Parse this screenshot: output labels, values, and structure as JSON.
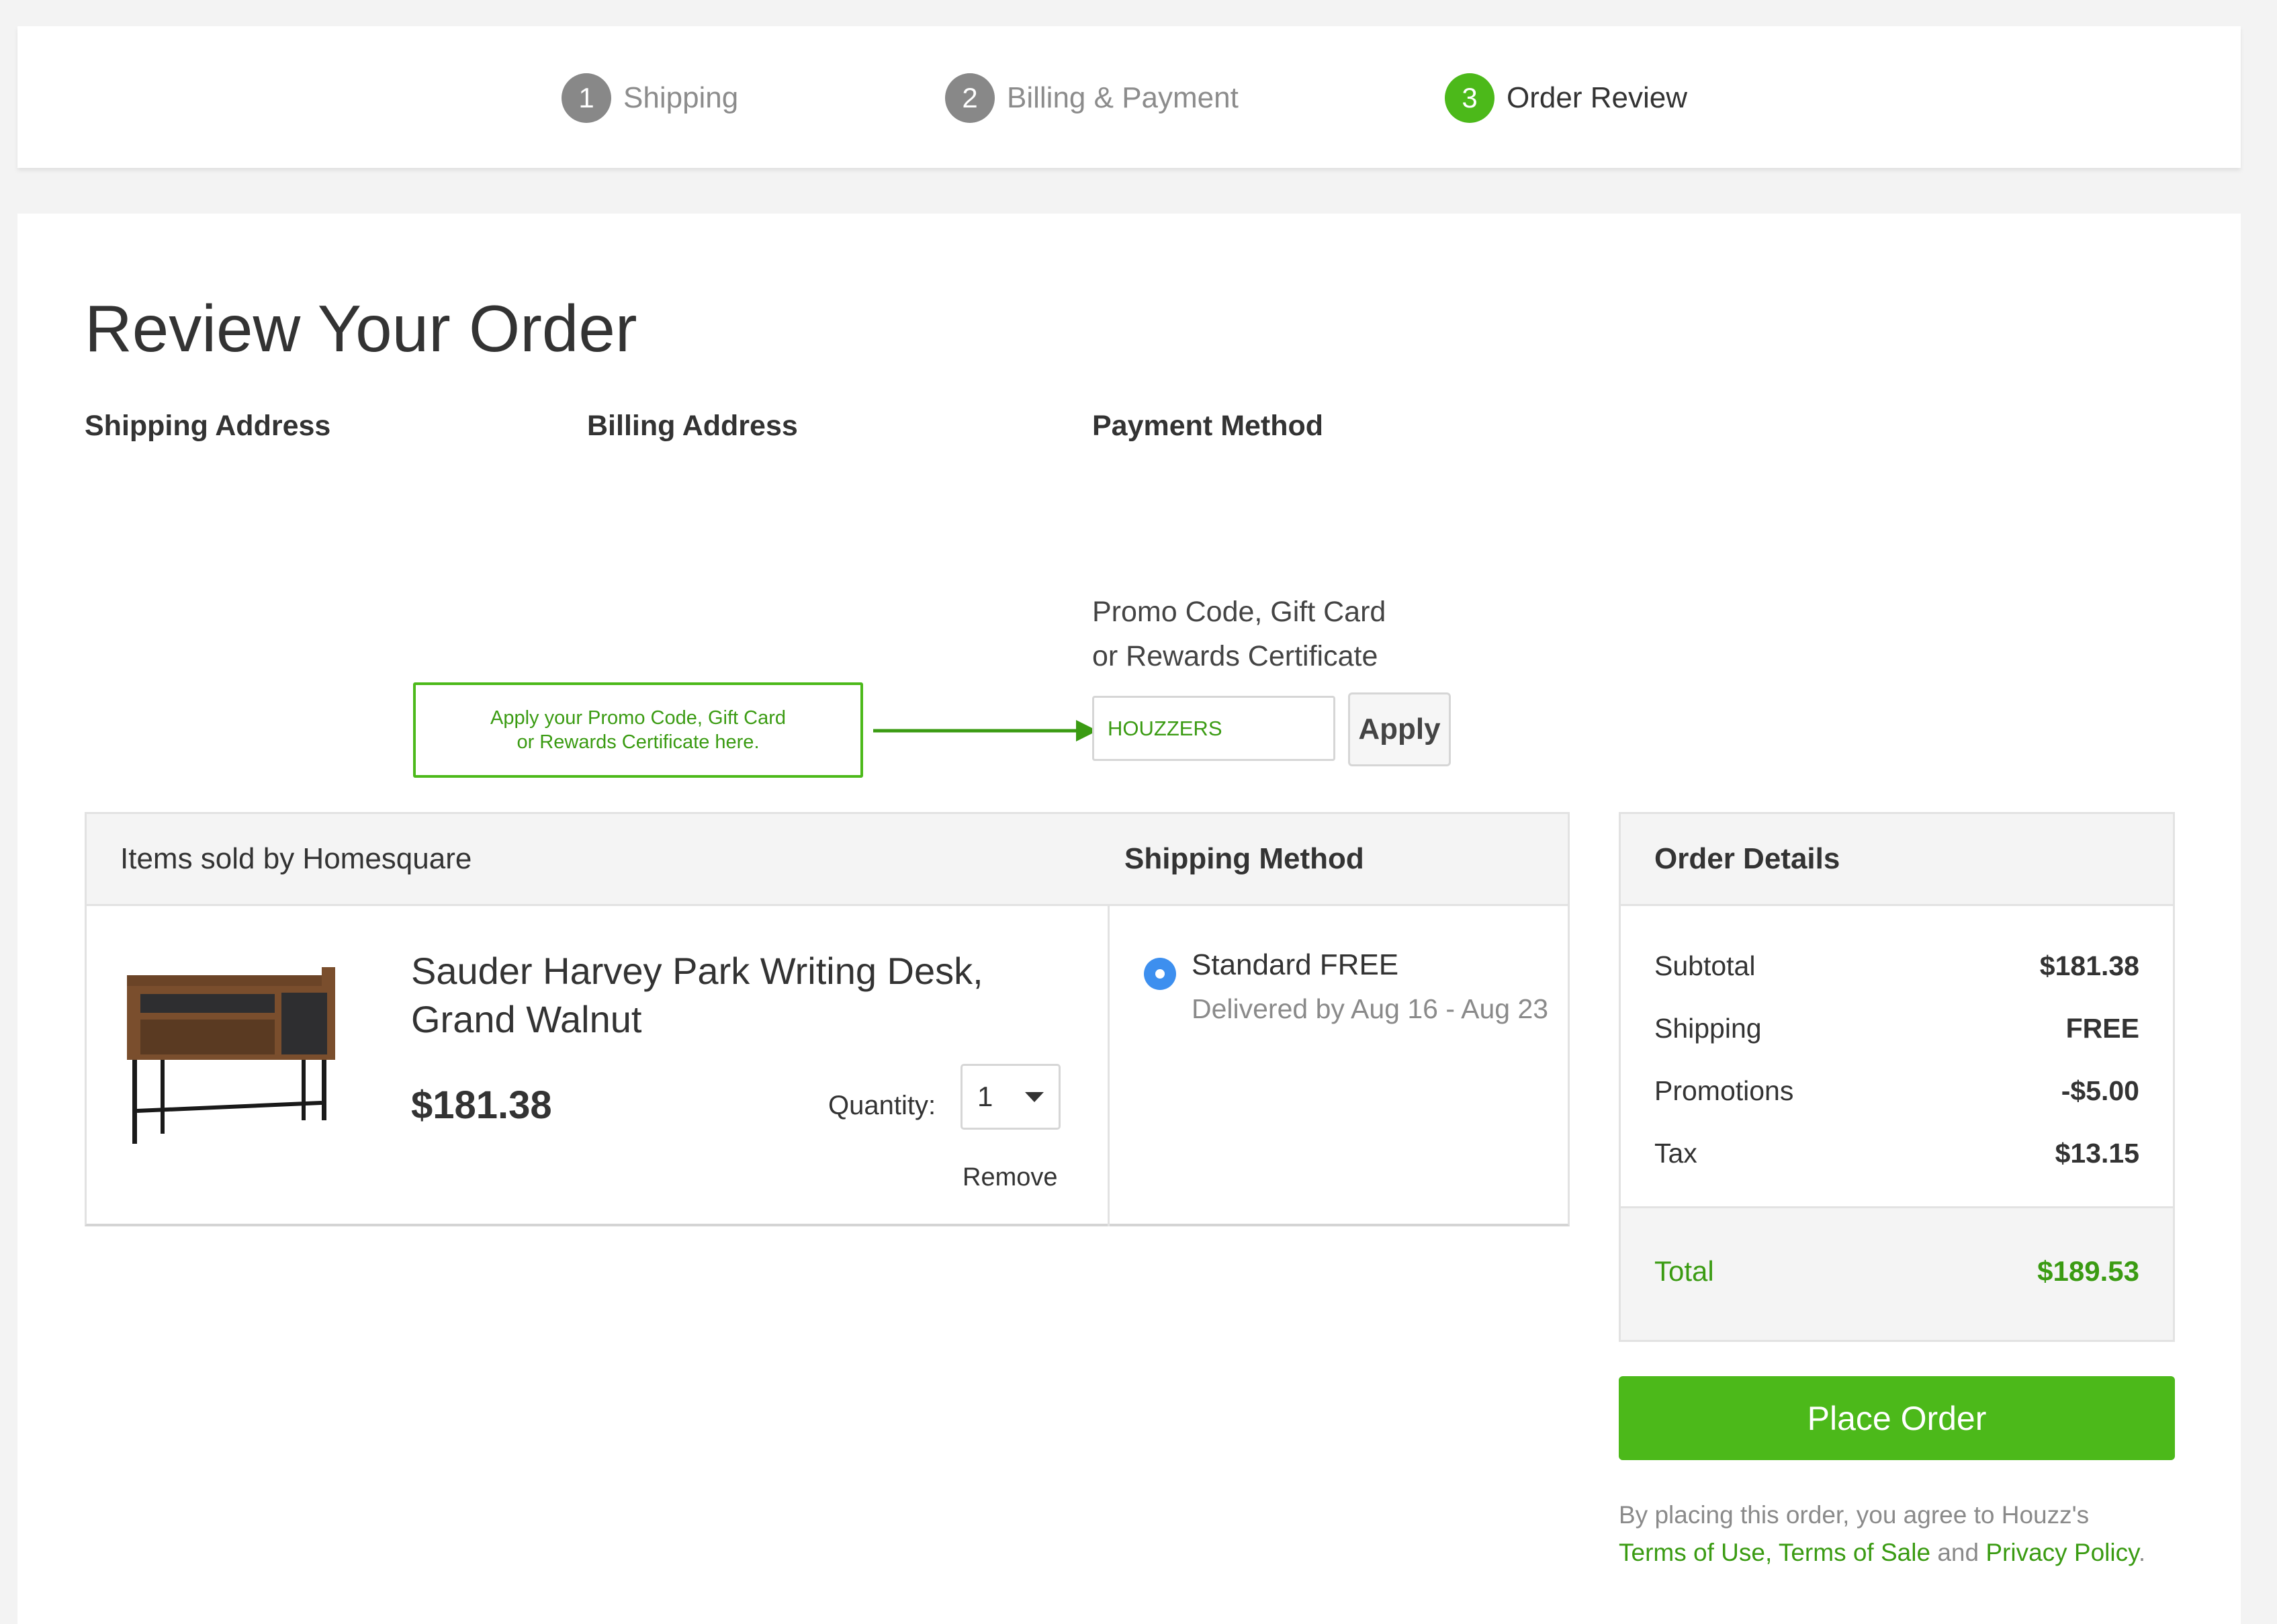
{
  "stepper": {
    "steps": [
      {
        "number": "1",
        "label": "Shipping",
        "state": "inactive"
      },
      {
        "number": "2",
        "label": "Billing & Payment",
        "state": "inactive"
      },
      {
        "number": "3",
        "label": "Order Review",
        "state": "active"
      }
    ]
  },
  "page": {
    "title": "Review Your Order",
    "columns": {
      "shipping_address": "Shipping Address",
      "billing_address": "Billing Address",
      "payment_method": "Payment Method"
    }
  },
  "promo": {
    "label_line1": "Promo Code, Gift Card",
    "label_line2": "or Rewards Certificate",
    "input_value": "HOUZZERS",
    "apply_label": "Apply",
    "callout_line1": "Apply your Promo Code, Gift Card",
    "callout_line2": "or Rewards Certificate here."
  },
  "items": {
    "header": "Items sold by Homesquare",
    "shipping_method_header": "Shipping Method",
    "product": {
      "name_line1": "Sauder Harvey Park Writing Desk,",
      "name_line2": "Grand Walnut",
      "price": "$181.38",
      "quantity_label": "Quantity:",
      "quantity_value": "1",
      "remove_label": "Remove",
      "image_icon": "writing-desk-image"
    },
    "shipping_option": {
      "label": "Standard FREE",
      "delivery": "Delivered by Aug 16 - Aug 23",
      "selected": true
    }
  },
  "order_details": {
    "title": "Order Details",
    "rows": [
      {
        "label": "Subtotal",
        "value": "$181.38"
      },
      {
        "label": "Shipping",
        "value": "FREE"
      },
      {
        "label": "Promotions",
        "value": "-$5.00"
      },
      {
        "label": "Tax",
        "value": "$13.15"
      }
    ],
    "total_label": "Total",
    "total_value": "$189.53"
  },
  "place_order_label": "Place Order",
  "terms": {
    "prefix": "By placing this order, you agree to Houzz's",
    "terms_of_use": "Terms of Use",
    "comma": ", ",
    "terms_of_sale": "Terms of Sale",
    "and": " and ",
    "privacy_policy": "Privacy Policy",
    "period": "."
  },
  "colors": {
    "accent_green": "#4cb91a",
    "text_green": "#3a9b12",
    "radio_blue": "#3d8fef",
    "inactive_step": "#888888"
  }
}
